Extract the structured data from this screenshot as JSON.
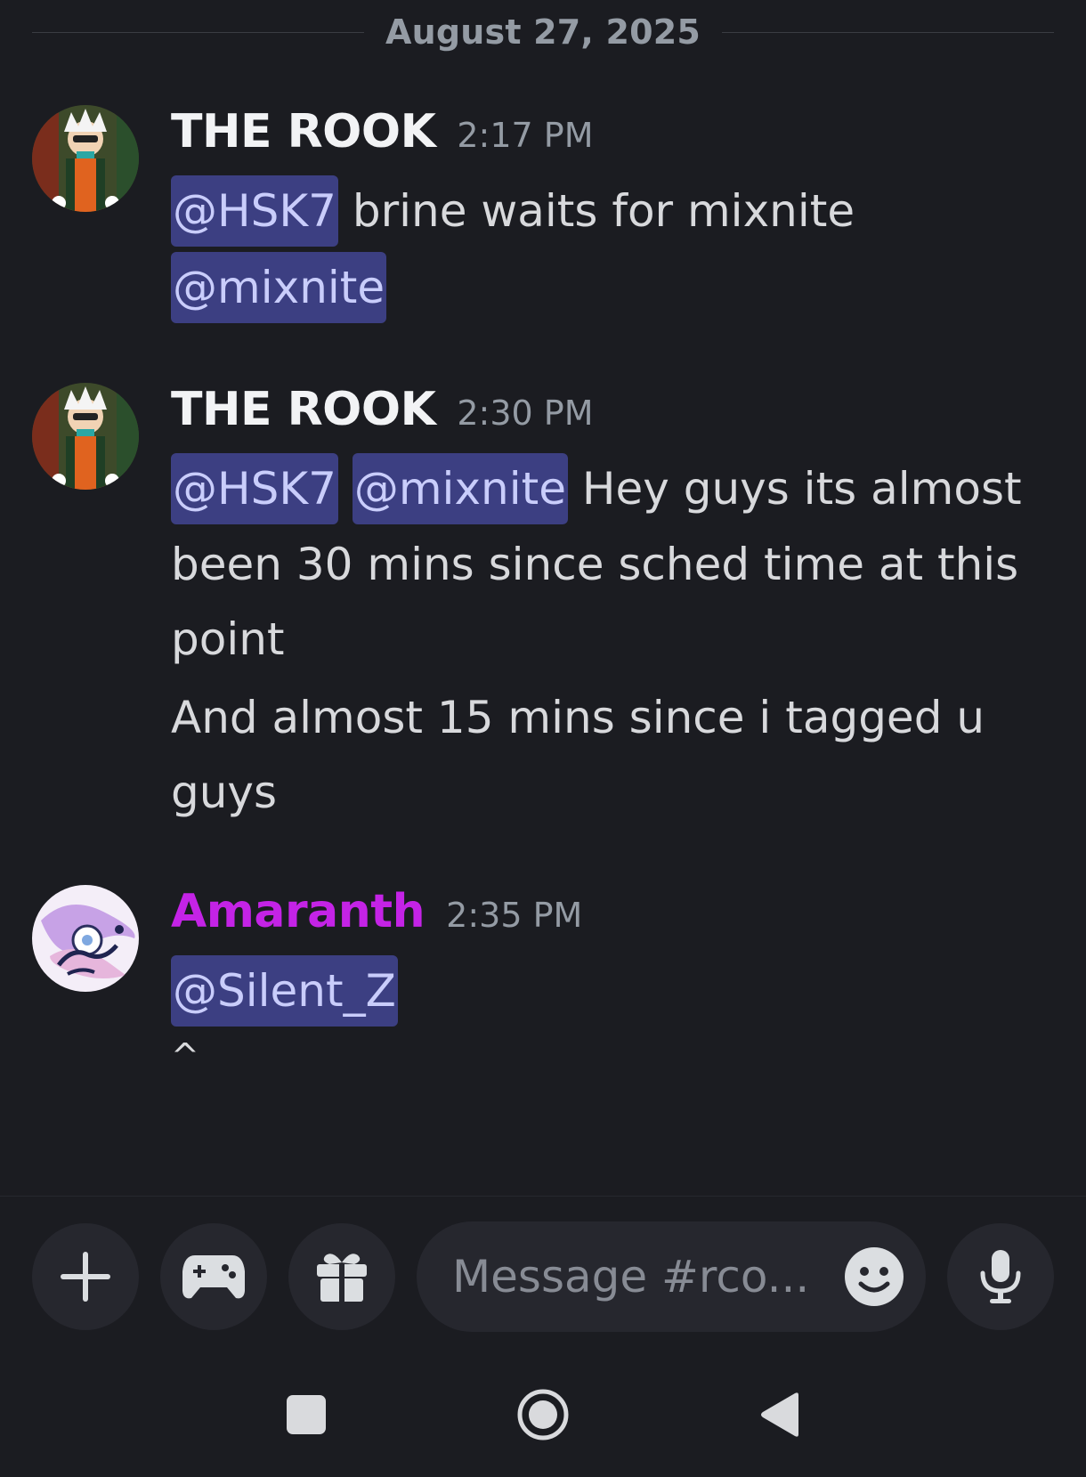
{
  "date_divider": "August 27, 2025",
  "messages": [
    {
      "username": "THE ROOK",
      "time": "2:17 PM",
      "line1_mention": "@HSK7",
      "line1_text": " brine waits for mixnite",
      "line2_mention": "@mixnite"
    },
    {
      "username": "THE ROOK",
      "time": "2:30 PM",
      "line1_mention_a": "@HSK7",
      "line1_mention_b": "@mixnite",
      "line1_text": " Hey guys its almost",
      "line2": "been 30 mins since sched time at this",
      "line3": "point",
      "line4": "And almost 15 mins since i tagged u",
      "line5": "guys"
    },
    {
      "username": "Amaranth",
      "username_color": "#c423e6",
      "time": "2:35 PM",
      "line1_mention": "@Silent_Z",
      "line2": "^"
    }
  ],
  "composer": {
    "placeholder": "Message #rco...",
    "add_icon": "plus-icon",
    "games_icon": "gamepad-icon",
    "gift_icon": "gift-icon",
    "emoji_icon": "emoji-icon",
    "mic_icon": "microphone-icon"
  },
  "system_nav": {
    "recents_icon": "square-icon",
    "home_icon": "circle-icon",
    "back_icon": "triangle-back-icon"
  },
  "colors": {
    "background": "#1b1c21",
    "mention_bg": "#3c3f82",
    "mention_text": "#c9cdfb",
    "amaranth_name": "#c423e6"
  }
}
